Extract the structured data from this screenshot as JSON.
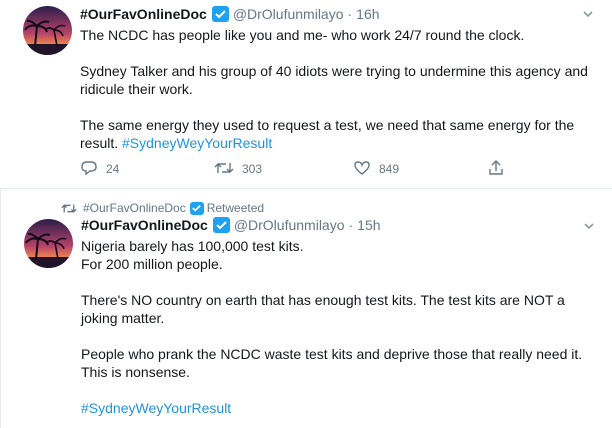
{
  "tweets": [
    {
      "display_name": "#OurFavOnlineDoc",
      "handle": "@DrOlufunmilayo",
      "separator": "·",
      "time": "16h",
      "paragraphs": [
        "The NCDC has people like you and me- who work 24/7 round the clock.",
        "Sydney Talker and his group of 40 idiots were trying to undermine this agency and ridicule their work.",
        "The same energy they used to request a test, we need that same energy for the result."
      ],
      "hashtag": "#SydneyWeyYourResult",
      "replies": "24",
      "retweets": "303",
      "likes": "849"
    },
    {
      "retweet_context": {
        "name": "#OurFavOnlineDoc",
        "label": "Retweeted"
      },
      "display_name": "#OurFavOnlineDoc",
      "handle": "@DrOlufunmilayo",
      "separator": "·",
      "time": "15h",
      "paragraphs": [
        "Nigeria barely has 100,000 test kits.\nFor 200 million people.",
        "There's NO country on earth that has enough test kits. The test kits are NOT a joking matter.",
        "People who prank the NCDC waste test kits and deprive those that really need it. This is nonsense.",
        ""
      ],
      "hashtag": "#SydneyWeyYourResult"
    }
  ],
  "colors": {
    "accent": "#1da1f2",
    "hashtag": "#1b95e0",
    "secondary_text": "#657786",
    "primary_text": "#14171a"
  }
}
